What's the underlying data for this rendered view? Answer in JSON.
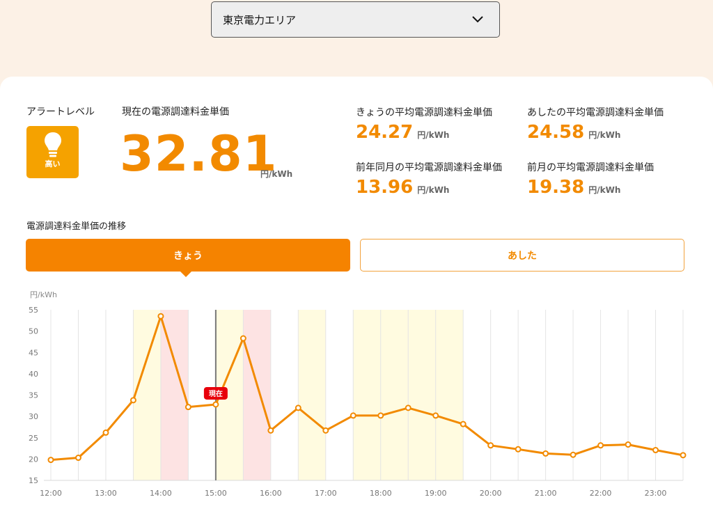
{
  "area_select": {
    "value": "東京電力エリア",
    "icon": "chevron-down-icon"
  },
  "alert": {
    "label": "アラートレベル",
    "level": "高い",
    "color": "#f5a200",
    "icon": "lightbulb-icon"
  },
  "current": {
    "label": "現在の電源調達料金単価",
    "value": "32.81",
    "unit": "円/kWh"
  },
  "stats": [
    {
      "label": "きょうの平均電源調達料金単価",
      "value": "24.27",
      "unit": "円/kWh"
    },
    {
      "label": "あしたの平均電源調達料金単価",
      "value": "24.58",
      "unit": "円/kWh"
    },
    {
      "label": "前年同月の平均電源調達料金単価",
      "value": "13.96",
      "unit": "円/kWh"
    },
    {
      "label": "前月の平均電源調達料金単価",
      "value": "19.38",
      "unit": "円/kWh"
    }
  ],
  "trend": {
    "title": "電源調達料金単価の推移"
  },
  "tabs": {
    "today": "きょう",
    "tomorrow": "あした",
    "active": "today"
  },
  "colors": {
    "accent": "#f28a00",
    "tab_active": "#f58300",
    "band_yellow": "#fffbe0",
    "band_pink": "#fde3e3",
    "now_marker": "#e8000b"
  },
  "chart_data": {
    "type": "line",
    "ylabel": "円/kWh",
    "ylim": [
      15,
      55
    ],
    "yticks": [
      15,
      20,
      25,
      30,
      35,
      40,
      45,
      50,
      55
    ],
    "xlim": [
      12.0,
      23.5
    ],
    "xticks": [
      "12:00",
      "13:00",
      "14:00",
      "15:00",
      "16:00",
      "17:00",
      "18:00",
      "19:00",
      "20:00",
      "21:00",
      "22:00",
      "23:00"
    ],
    "grid": true,
    "series": [
      {
        "x": [
          "12:00",
          "12:30",
          "13:00",
          "13:30",
          "14:00",
          "14:30",
          "15:00",
          "15:30",
          "16:00",
          "16:30",
          "17:00",
          "17:30",
          "18:00",
          "18:30",
          "19:00",
          "19:30",
          "20:00",
          "20:30",
          "21:00",
          "21:30",
          "22:00",
          "22:30",
          "23:00",
          "23:30"
        ],
        "values": [
          19.8,
          20.3,
          26.2,
          33.8,
          53.5,
          32.2,
          32.8,
          48.3,
          26.7,
          32.0,
          26.7,
          30.2,
          30.2,
          32.0,
          30.2,
          28.2,
          23.2,
          22.3,
          21.3,
          21.0,
          23.2,
          23.4,
          22.1,
          20.9
        ]
      }
    ],
    "bands_yellow": [
      [
        "13:30",
        "14:00"
      ],
      [
        "15:00",
        "15:30"
      ],
      [
        "16:30",
        "17:00"
      ],
      [
        "17:30",
        "19:30"
      ]
    ],
    "bands_pink": [
      [
        "14:00",
        "14:30"
      ],
      [
        "15:30",
        "16:00"
      ]
    ],
    "now": {
      "time": "15:00",
      "label": "現在"
    }
  }
}
